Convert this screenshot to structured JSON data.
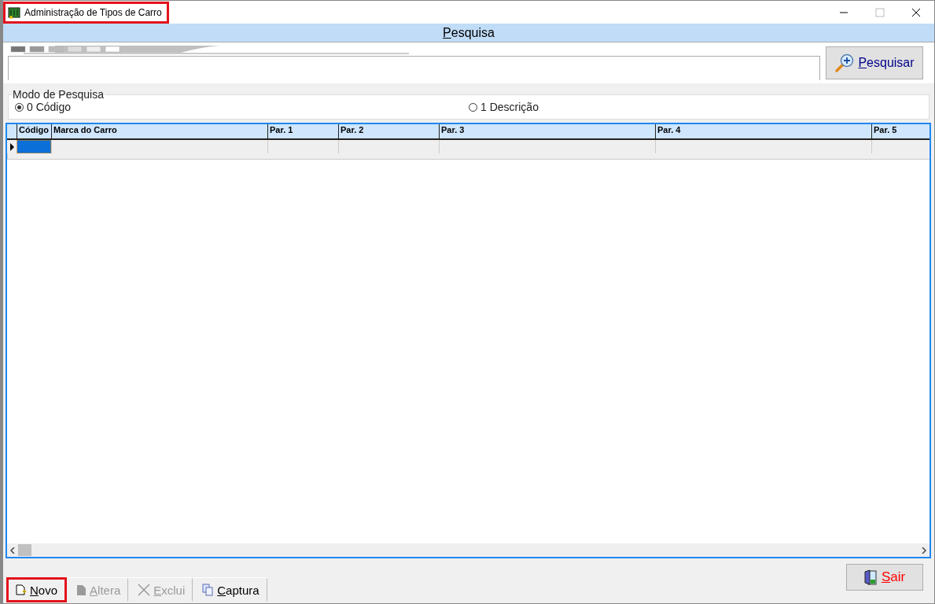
{
  "window": {
    "title": "Administração de Tipos de Carro",
    "highlighted": true
  },
  "header": {
    "title": "Pesquisa"
  },
  "search": {
    "button": "Pesquisar"
  },
  "search_mode": {
    "legend": "Modo de Pesquisa",
    "options": [
      {
        "label": "0 Código",
        "selected": true
      },
      {
        "label": "1 Descrição",
        "selected": false
      }
    ]
  },
  "table": {
    "columns": [
      "Código",
      "Marca do Carro",
      "Par. 1",
      "Par. 2",
      "Par. 3",
      "Par. 4",
      "Par. 5"
    ],
    "rows": [
      {
        "current": true
      }
    ]
  },
  "toolbar": [
    {
      "kind": "new",
      "label": "Novo",
      "disabled": false,
      "highlighted": true
    },
    {
      "kind": "edit",
      "label": "Altera",
      "disabled": true,
      "highlighted": false
    },
    {
      "kind": "delete",
      "label": "Exclui",
      "disabled": true,
      "highlighted": false
    },
    {
      "kind": "capture",
      "label": "Captura",
      "disabled": false,
      "highlighted": false
    }
  ],
  "exit_button": {
    "label": "Sair"
  }
}
